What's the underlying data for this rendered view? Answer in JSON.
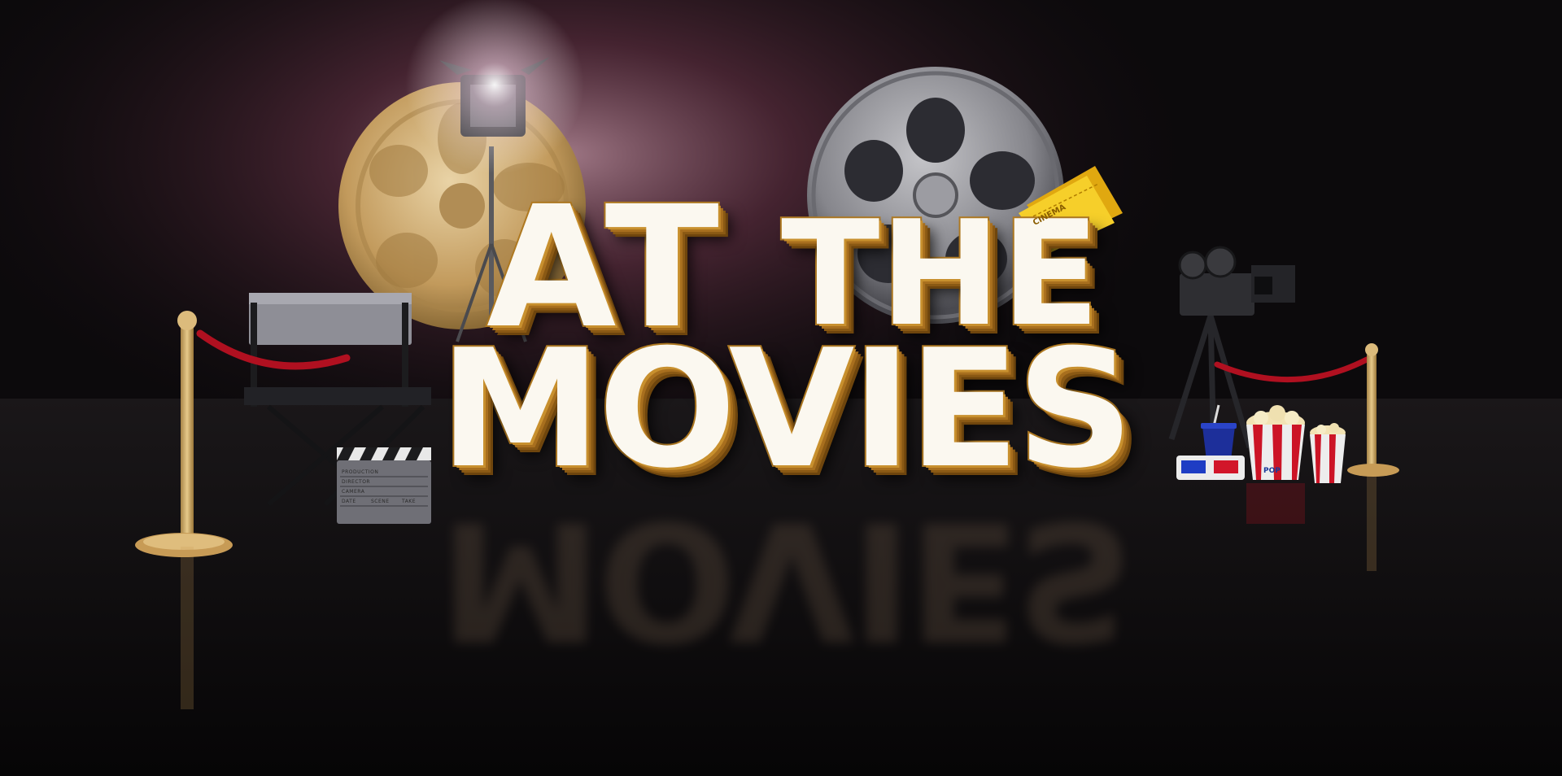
{
  "title": {
    "line1_a": "AT",
    "line1_b": "THE",
    "line2": "MOVIES"
  },
  "props": {
    "ticket_label": "CINEMA",
    "clapper_fields": [
      "PRODUCTION",
      "DIRECTOR",
      "CAMERA",
      "DATE",
      "SCENE",
      "TAKE"
    ],
    "popcorn_label": "POP"
  },
  "colors": {
    "background": "#0b090b",
    "letter_face": "#fbf8f0",
    "letter_gold": "#b07a22",
    "gold_reel": "#c8a66a",
    "silver_reel": "#8d8d92",
    "velvet_rope": "#b01020",
    "ticket": "#f2c21a"
  }
}
